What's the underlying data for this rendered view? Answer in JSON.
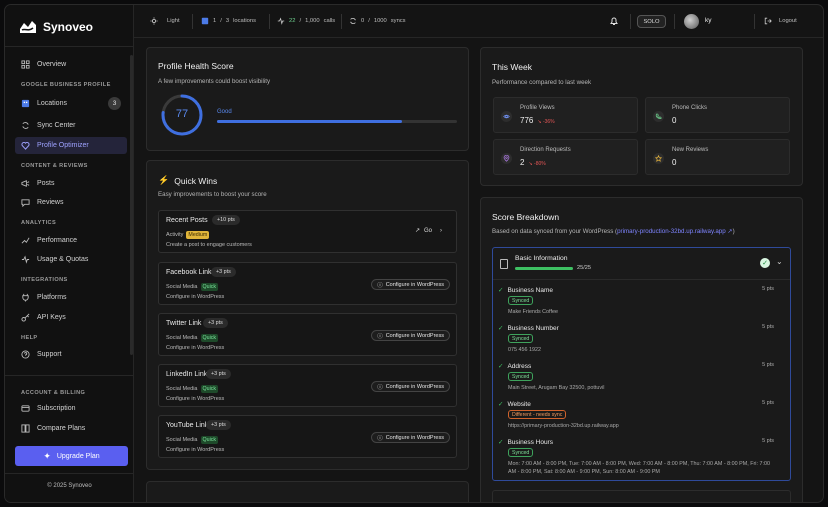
{
  "app": {
    "name": "Synoveo",
    "copyright": "© 2025 Synoveo"
  },
  "sidebar": {
    "overview": "Overview",
    "sections": {
      "gbp": "GOOGLE BUSINESS PROFILE",
      "content": "CONTENT & REVIEWS",
      "analytics": "ANALYTICS",
      "integrations": "INTEGRATIONS",
      "help": "HELP",
      "account": "ACCOUNT & BILLING"
    },
    "items": {
      "locations": "Locations",
      "locations_count": "3",
      "sync_center": "Sync Center",
      "profile_optimizer": "Profile Optimizer",
      "posts": "Posts",
      "reviews": "Reviews",
      "performance": "Performance",
      "usage": "Usage & Quotas",
      "platforms": "Platforms",
      "api_keys": "API Keys",
      "support": "Support",
      "subscription": "Subscription",
      "compare_plans": "Compare Plans"
    },
    "upgrade": "Upgrade Plan"
  },
  "topbar": {
    "theme": "Light",
    "locations_used": "1",
    "locations_sep": "/",
    "locations_total": "3",
    "locations_label": "locations",
    "calls_used": "22",
    "calls_sep": "/",
    "calls_total": "1,000",
    "calls_label": "calls",
    "syncs_used": "0",
    "syncs_sep": "/",
    "syncs_total": "1000",
    "syncs_label": "syncs",
    "plan": "SOLO",
    "user": "ky",
    "logout": "Logout"
  },
  "health": {
    "title": "Profile Health Score",
    "subtitle": "A few improvements could boost visibility",
    "score": "77",
    "score_fraction": 0.77,
    "label": "Good",
    "bar_fraction": 0.77,
    "accent": "#3f6fe0"
  },
  "quick_wins": {
    "title": "Quick Wins",
    "subtitle": "Easy improvements to boost your score",
    "go": "Go",
    "configure": "Configure in WordPress",
    "items": [
      {
        "title": "Recent Posts",
        "pts": "+10 pts",
        "category": "Activity",
        "tag": "Medium",
        "desc": "Create a post to engage customers"
      },
      {
        "title": "Facebook Link",
        "pts": "+3 pts",
        "category": "Social Media",
        "tag": "Quick",
        "desc": "Configure in WordPress"
      },
      {
        "title": "Twitter Link",
        "pts": "+3 pts",
        "category": "Social Media",
        "tag": "Quick",
        "desc": "Configure in WordPress"
      },
      {
        "title": "LinkedIn Link",
        "pts": "+3 pts",
        "category": "Social Media",
        "tag": "Quick",
        "desc": "Configure in WordPress"
      },
      {
        "title": "YouTube Link",
        "pts": "+3 pts",
        "category": "Social Media",
        "tag": "Quick",
        "desc": "Configure in WordPress"
      }
    ]
  },
  "week": {
    "title": "This Week",
    "subtitle": "Performance compared to last week",
    "stats": [
      {
        "label": "Profile Views",
        "value": "776",
        "delta": "↘ -36%"
      },
      {
        "label": "Phone Clicks",
        "value": "0",
        "delta": ""
      },
      {
        "label": "Direction Requests",
        "value": "2",
        "delta": "↘ -80%"
      },
      {
        "label": "New Reviews",
        "value": "0",
        "delta": ""
      }
    ]
  },
  "breakdown": {
    "title": "Score Breakdown",
    "subtitle_prefix": "Based on data synced from your WordPress (",
    "subtitle_link": "primary-production-32bd.up.railway.app",
    "subtitle_suffix": ")",
    "section": {
      "title": "Basic Information",
      "progress": "25/25",
      "fraction": 1.0
    },
    "fields": [
      {
        "name": "Business Name",
        "pts": "5 pts",
        "status": "Synced",
        "value": "Make Friends Coffee"
      },
      {
        "name": "Business Number",
        "pts": "5 pts",
        "status": "Synced",
        "value": "075 456 1922"
      },
      {
        "name": "Address",
        "pts": "5 pts",
        "status": "Synced",
        "value": "Main Street, Arugam Bay 32500, pottuvil"
      },
      {
        "name": "Website",
        "pts": "5 pts",
        "status": "Different - needs sync",
        "value": "https://primary-production-32bd.up.railway.app"
      },
      {
        "name": "Business Hours",
        "pts": "5 pts",
        "status": "Synced",
        "value": "Mon: 7:00 AM - 8:00 PM, Tue: 7:00 AM - 8:00 PM, Wed: 7:00 AM - 8:00 PM, Thu: 7:00 AM - 8:00 PM, Fri: 7:00 AM - 8:00 PM, Sat: 8:00 AM - 9:00 PM, Sun: 8:00 AM - 9:00 PM"
      }
    ]
  }
}
